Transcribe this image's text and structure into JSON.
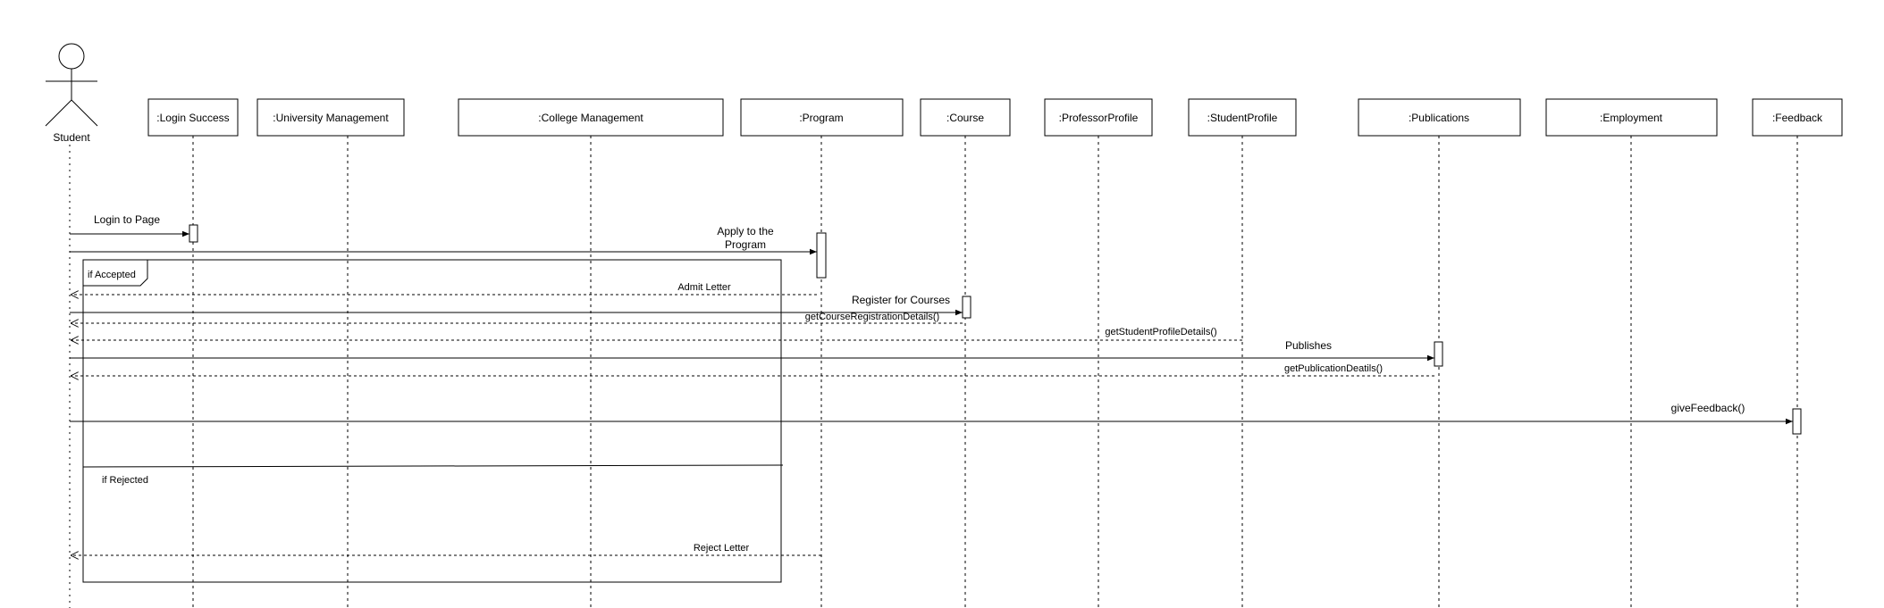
{
  "diagram": {
    "actor": {
      "label": "Student"
    },
    "lifelines": [
      {
        "id": "login-success",
        "label": ":Login Success"
      },
      {
        "id": "university-management",
        "label": ":University Management"
      },
      {
        "id": "college-management",
        "label": ":College Management"
      },
      {
        "id": "program",
        "label": ":Program"
      },
      {
        "id": "course",
        "label": ":Course"
      },
      {
        "id": "professor-profile",
        "label": ":ProfessorProfile"
      },
      {
        "id": "student-profile",
        "label": ":StudentProfile"
      },
      {
        "id": "publications",
        "label": ":Publications"
      },
      {
        "id": "employment",
        "label": ":Employment"
      },
      {
        "id": "feedback",
        "label": ":Feedback"
      }
    ],
    "fragment": {
      "accepted_guard": "if Accepted",
      "rejected_guard": "if Rejected"
    },
    "messages": [
      {
        "id": "login-to-page",
        "label": "Login to Page"
      },
      {
        "id": "apply-to-program",
        "label_lines": [
          "Apply to the",
          "Program"
        ]
      },
      {
        "id": "admit-letter",
        "label": "Admit Letter"
      },
      {
        "id": "register-for-courses",
        "label": "Register for Courses"
      },
      {
        "id": "get-course-registration-details",
        "label": "getCourseRegistrationDetails()"
      },
      {
        "id": "get-student-profile-details",
        "label": "getStudentProfileDetails()"
      },
      {
        "id": "publishes",
        "label": "Publishes"
      },
      {
        "id": "get-publication-details",
        "label": "getPublicationDeatils()"
      },
      {
        "id": "give-feedback",
        "label": "giveFeedback()"
      },
      {
        "id": "reject-letter",
        "label": "Reject Letter"
      }
    ]
  }
}
